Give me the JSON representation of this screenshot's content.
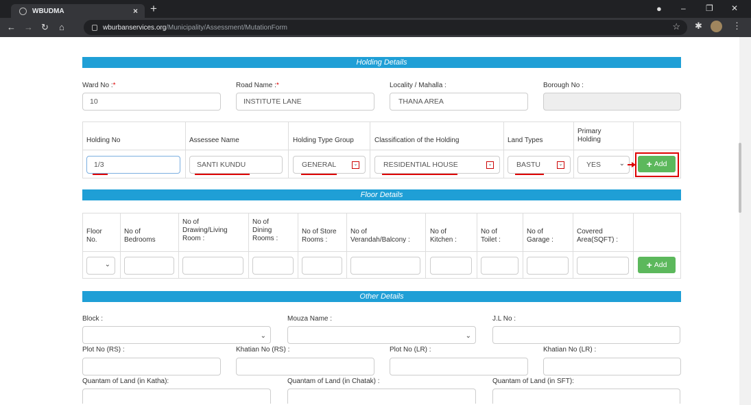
{
  "browser": {
    "tab_title": "WBUDMA",
    "url_host": "wburbanservices.org",
    "url_path": "/Municipality/Assessment/MutationForm"
  },
  "holding_details": {
    "header": "Holding Details",
    "ward_label": "Ward No :",
    "ward_value": "10",
    "road_label": "Road Name :",
    "road_value": "INSTITUTE LANE",
    "locality_label": "Locality / Mahalla :",
    "locality_value": "THANA AREA",
    "borough_label": "Borough No :",
    "borough_value": "",
    "table": {
      "col_holding_no": "Holding No",
      "col_assessee": "Assessee Name",
      "col_type_group": "Holding Type Group",
      "col_classification": "Classification of the Holding",
      "col_land_types": "Land Types",
      "col_primary_1": "Primary",
      "col_primary_2": "Holding",
      "holding_no": "1/3",
      "assessee": "SANTI KUNDU",
      "type_group": "GENERAL",
      "classification": "RESIDENTIAL HOUSE",
      "land_type": "BASTU",
      "primary": "YES",
      "add_label": "Add"
    }
  },
  "floor_details": {
    "header": "Floor Details",
    "cols": {
      "floor_1": "Floor",
      "floor_2": "No.",
      "bed_1": "No of",
      "bed_2": "Bedrooms",
      "draw_1": "No of",
      "draw_2": "Drawing/Living",
      "draw_3": "Room :",
      "dining_1": "No of",
      "dining_2": "Dining",
      "dining_3": "Rooms :",
      "store_1": "No of Store",
      "store_2": "Rooms :",
      "veran_1": "No of",
      "veran_2": "Verandah/Balcony :",
      "kitchen_1": "No of",
      "kitchen_2": "Kitchen :",
      "toilet_1": "No of",
      "toilet_2": "Toilet :",
      "garage_1": "No of",
      "garage_2": "Garage :",
      "area_1": "Covered",
      "area_2": "Area(SQFT) :"
    },
    "add_label": "Add"
  },
  "other_details": {
    "header": "Other Details",
    "block_label": "Block :",
    "mouza_label": "Mouza Name :",
    "jl_label": "J.L No :",
    "plot_rs_label": "Plot No (RS) :",
    "khatian_rs_label": "Khatian No (RS) :",
    "plot_lr_label": "Plot No (LR) :",
    "khatian_lr_label": "Khatian No (LR) :",
    "katha_label": "Quantam of Land (in Katha):",
    "chatak_label": "Quantam of Land (in Chatak) :",
    "sft_label": "Quantam of Land (in SFT):"
  }
}
